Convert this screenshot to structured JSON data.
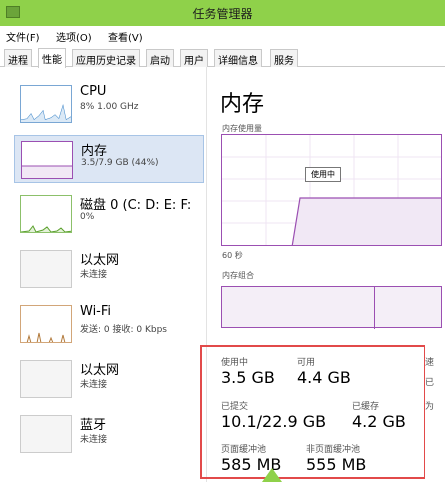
{
  "window": {
    "title": "任务管理器"
  },
  "menu": {
    "file": "文件(F)",
    "options": "选项(O)",
    "view": "查看(V)"
  },
  "tabs": [
    "进程",
    "性能",
    "应用历史记录",
    "启动",
    "用户",
    "详细信息",
    "服务"
  ],
  "sidebar": {
    "items": [
      {
        "name": "CPU",
        "sub": "8% 1.00 GHz"
      },
      {
        "name": "内存",
        "sub": "3.5/7.9 GB (44%)"
      },
      {
        "name": "磁盘 0 (C: D: E: F:",
        "sub": "0%"
      },
      {
        "name": "以太网",
        "sub": "未连接"
      },
      {
        "name": "Wi-Fi",
        "sub": "发送: 0 接收: 0 Kbps"
      },
      {
        "name": "以太网",
        "sub": "未连接"
      },
      {
        "name": "蓝牙",
        "sub": "未连接"
      }
    ]
  },
  "main": {
    "title": "内存",
    "usage_label": "内存使用量",
    "in_use_tooltip": "使用中",
    "time_label": "60 秒",
    "composition_label": "内存组合",
    "memory_usage_percent": 44
  },
  "stats": {
    "in_use": {
      "label": "使用中",
      "value": "3.5 GB"
    },
    "available": {
      "label": "可用",
      "value": "4.4 GB"
    },
    "committed": {
      "label": "已提交",
      "value": "10.1/22.9 GB"
    },
    "cached": {
      "label": "已缓存",
      "value": "4.2 GB"
    },
    "paged_pool": {
      "label": "页面缓冲池",
      "value": "585 MB"
    },
    "non_paged_pool": {
      "label": "非页面缓冲池",
      "value": "555 MB"
    },
    "right_cut": [
      "速",
      "已",
      "为"
    ]
  },
  "colors": {
    "titlebar": "#8fd14a",
    "memory": "#9b4fb2",
    "highlight_box": "#e24a4a"
  }
}
